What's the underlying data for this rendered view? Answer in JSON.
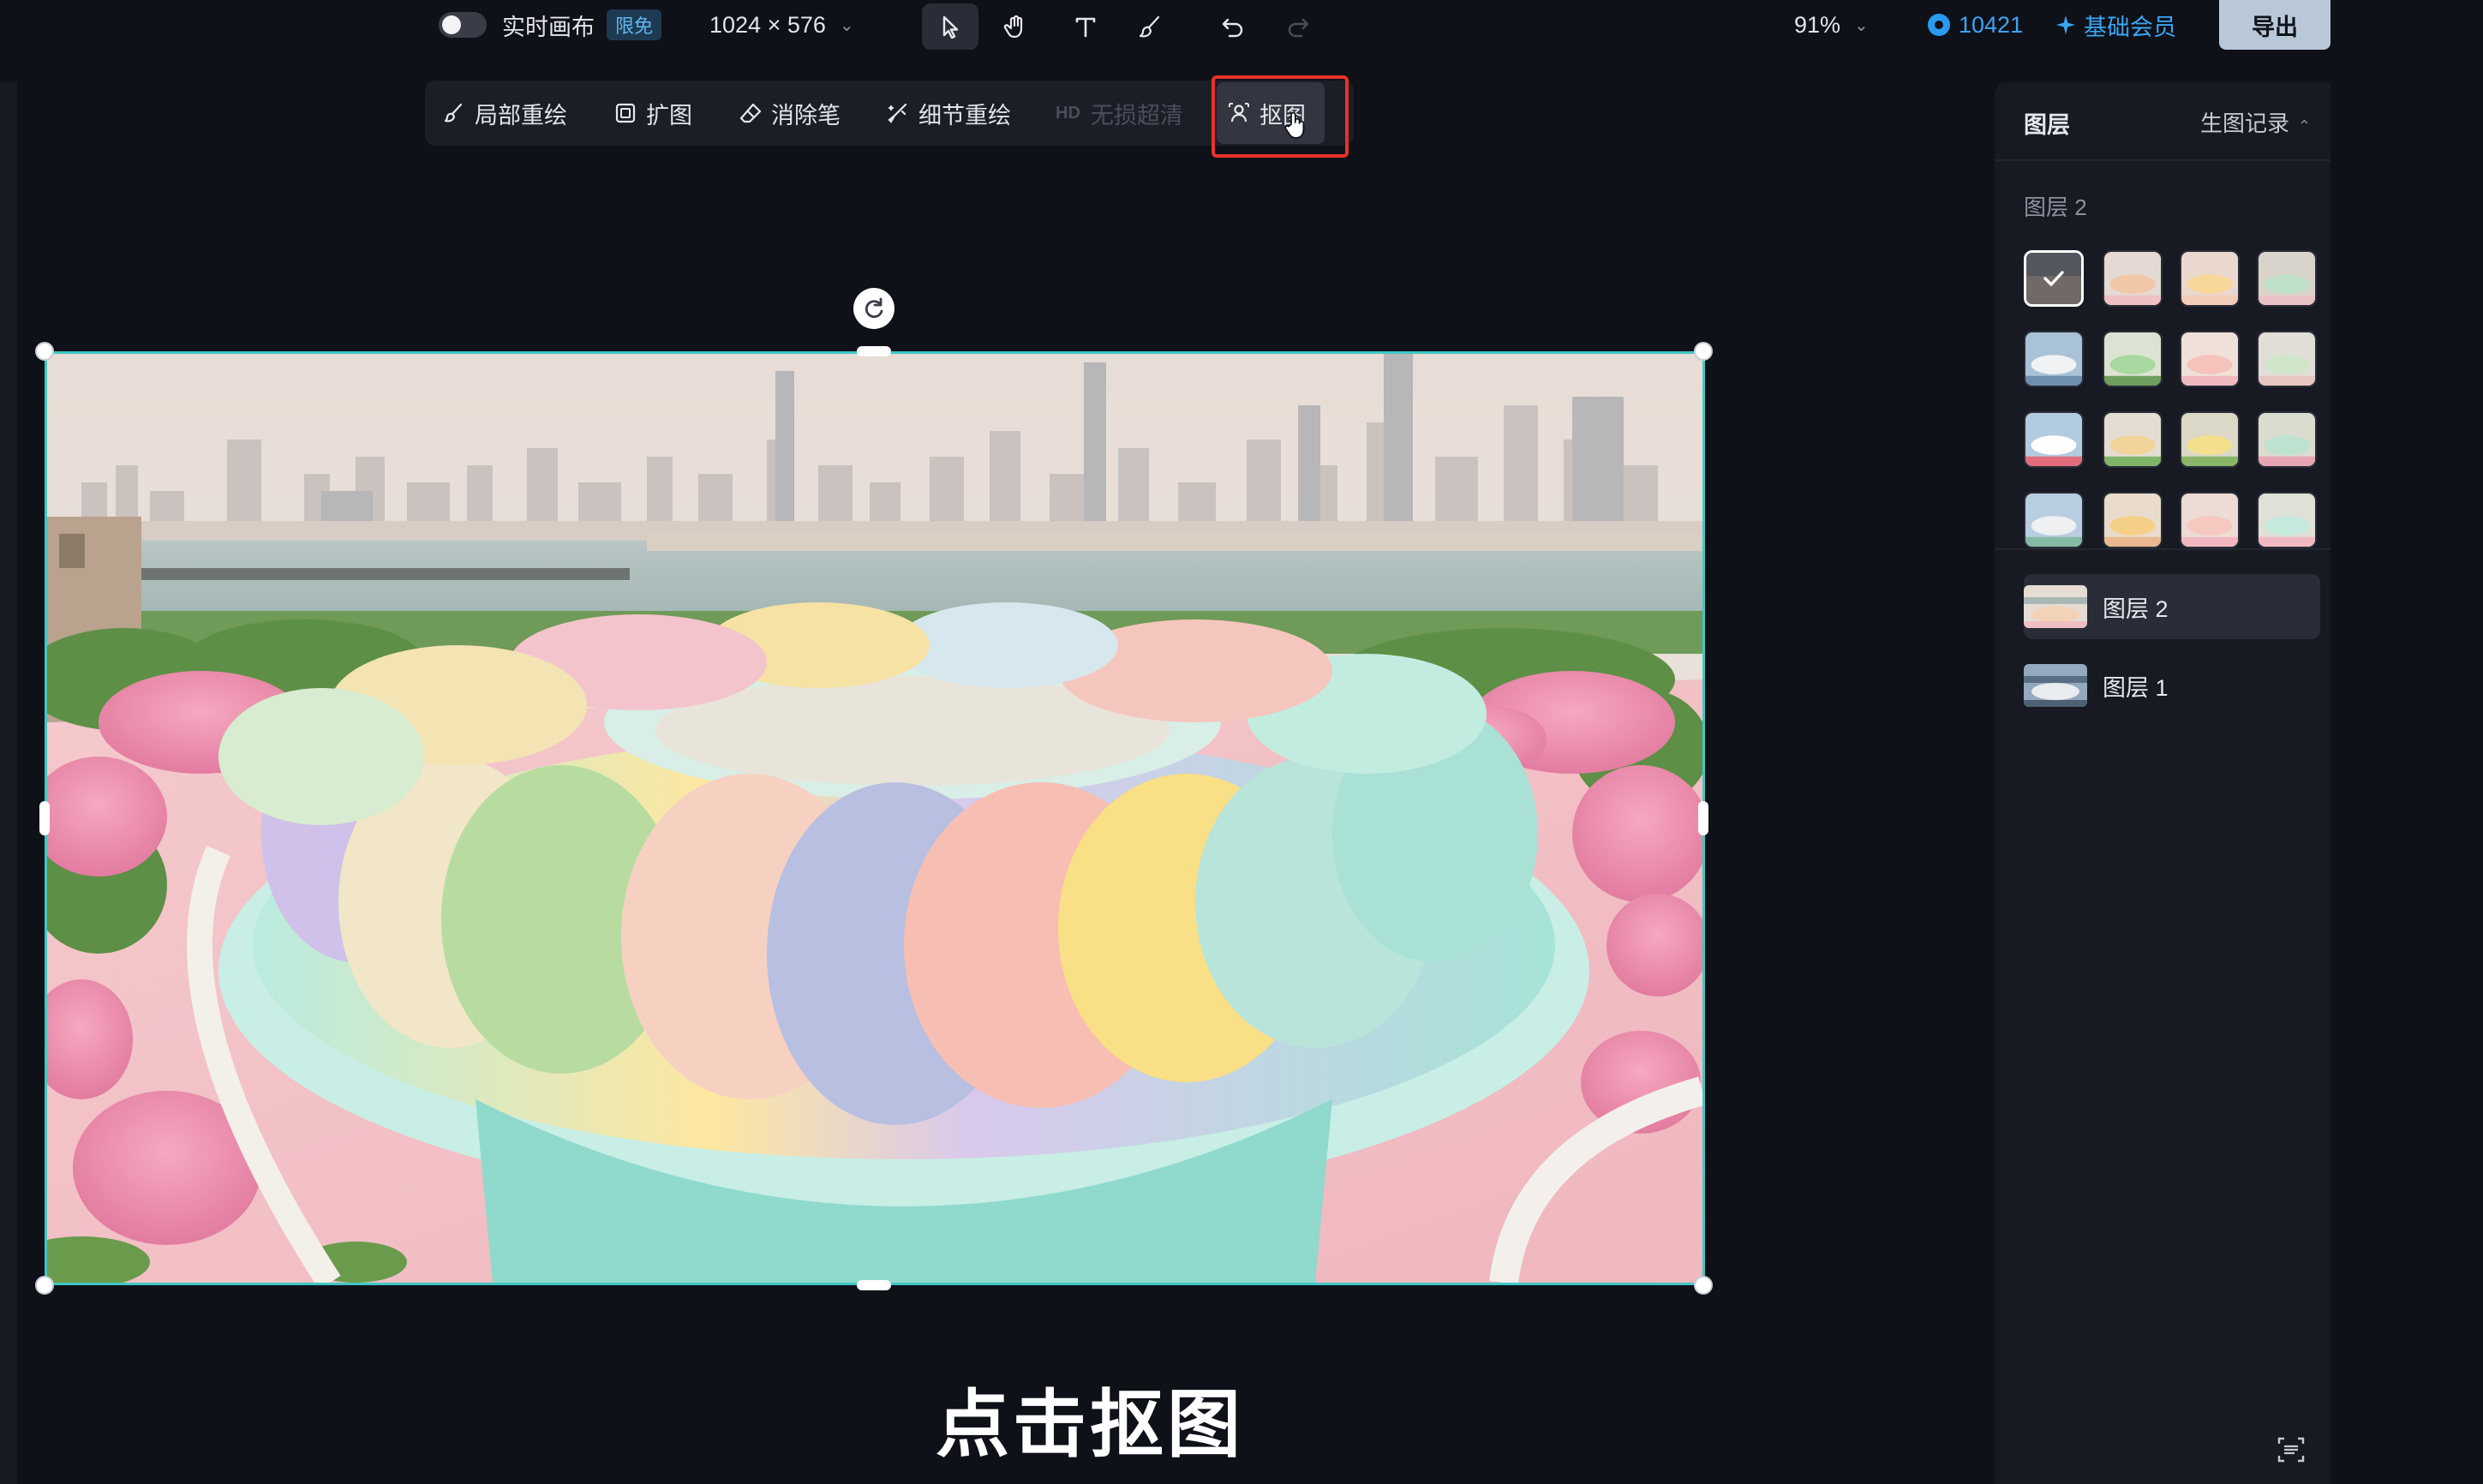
{
  "topbar": {
    "realtime_label": "实时画布",
    "free_badge": "限免",
    "size": "1024 × 576",
    "zoom": "91%",
    "credits": "10421",
    "member": "基础会员",
    "export": "导出"
  },
  "subtoolbar": {
    "inpaint": "局部重绘",
    "expand": "扩图",
    "eraser": "消除笔",
    "detail": "细节重绘",
    "hd_tag": "HD",
    "upscale": "无损超清",
    "cutout": "抠图"
  },
  "caption": "点击抠图",
  "panel": {
    "title": "图层",
    "history": "生图记录",
    "section": "图层 2",
    "layers": [
      {
        "label": "图层 2",
        "active": true
      },
      {
        "label": "图层 1",
        "active": false
      }
    ]
  },
  "colors": {
    "accent": "#3fc8c4",
    "brand_blue": "#3ba5f2",
    "highlight_red": "#e8322a"
  }
}
